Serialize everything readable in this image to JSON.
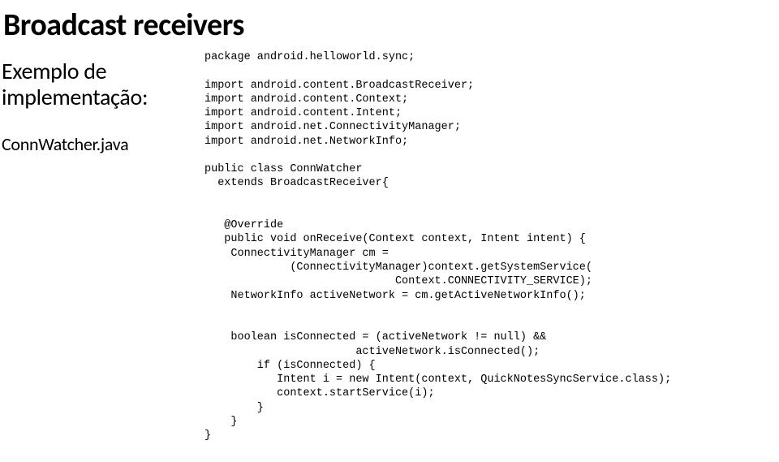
{
  "title": "Broadcast receivers",
  "subtitle_line1": "Exemplo de",
  "subtitle_line2": "implementação:",
  "filename": "ConnWatcher.java",
  "code": "package android.helloworld.sync;\n\nimport android.content.BroadcastReceiver;\nimport android.content.Context;\nimport android.content.Intent;\nimport android.net.ConnectivityManager;\nimport android.net.NetworkInfo;\n\npublic class ConnWatcher\n  extends BroadcastReceiver{\n\n\n   @Override\n   public void onReceive(Context context, Intent intent) {\n    ConnectivityManager cm =\n             (ConnectivityManager)context.getSystemService(\n                             Context.CONNECTIVITY_SERVICE);\n    NetworkInfo activeNetwork = cm.getActiveNetworkInfo();\n\n\n    boolean isConnected = (activeNetwork != null) &&\n                       activeNetwork.isConnected();\n        if (isConnected) {\n           Intent i = new Intent(context, QuickNotesSyncService.class);\n           context.startService(i);\n        }\n    }\n}"
}
